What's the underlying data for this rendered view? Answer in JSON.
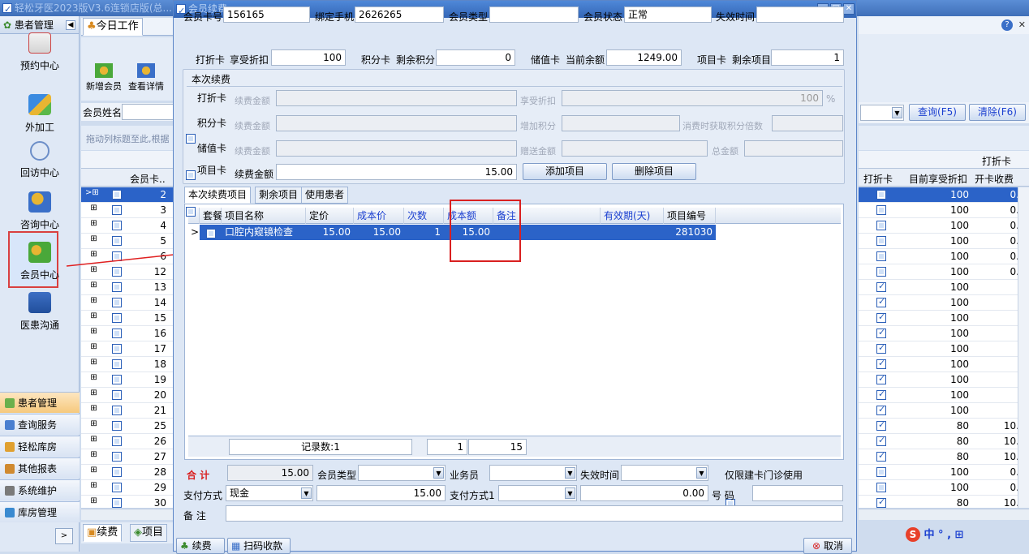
{
  "app": {
    "title": "轻松牙医2023版V3.6连锁店版(总...",
    "taskbar_right": "中 ° , ⊞"
  },
  "sidebar": {
    "header": "患者管理",
    "items": [
      {
        "label": "预约中心"
      },
      {
        "label": "外加工"
      },
      {
        "label": "回访中心"
      },
      {
        "label": "咨询中心"
      },
      {
        "label": "会员中心"
      },
      {
        "label": "医患沟通"
      }
    ],
    "bottom": [
      {
        "label": "患者管理"
      },
      {
        "label": "查询服务"
      },
      {
        "label": "轻松库房"
      },
      {
        "label": "其他报表"
      },
      {
        "label": "系统维护"
      },
      {
        "label": "库房管理"
      }
    ]
  },
  "bg": {
    "tab_today": "今日工作",
    "btn_new_member": "新增会员",
    "btn_view_detail": "查看详情",
    "member_name_label": "会员姓名",
    "drag_hint": "拖动列标题至此,根据",
    "col_card": "会员卡..",
    "rows": [
      "2",
      "3",
      "4",
      "5",
      "6",
      "12",
      "13",
      "14",
      "15",
      "16",
      "17",
      "18",
      "19",
      "20",
      "21",
      "25",
      "26",
      "27",
      "28",
      "29",
      "30"
    ],
    "btn_query": "查询(F5)",
    "btn_clear": "清除(F6)",
    "right_group": "打折卡",
    "right_cols": [
      "打折卡",
      "目前享受折扣",
      "开卡收费"
    ],
    "right_rows": [
      {
        "disc": "100",
        "fee": "0."
      },
      {
        "disc": "100",
        "fee": "0."
      },
      {
        "disc": "100",
        "fee": "0."
      },
      {
        "disc": "100",
        "fee": "0."
      },
      {
        "disc": "100",
        "fee": "0."
      },
      {
        "disc": "100",
        "fee": "0."
      },
      {
        "disc": "100",
        "fee": ""
      },
      {
        "disc": "100",
        "fee": ""
      },
      {
        "disc": "100",
        "fee": ""
      },
      {
        "disc": "100",
        "fee": ""
      },
      {
        "disc": "100",
        "fee": ""
      },
      {
        "disc": "100",
        "fee": ""
      },
      {
        "disc": "100",
        "fee": ""
      },
      {
        "disc": "100",
        "fee": ""
      },
      {
        "disc": "100",
        "fee": ""
      },
      {
        "disc": "80",
        "fee": "10."
      },
      {
        "disc": "80",
        "fee": "10."
      },
      {
        "disc": "80",
        "fee": "10."
      },
      {
        "disc": "100",
        "fee": "0."
      },
      {
        "disc": "100",
        "fee": "0."
      },
      {
        "disc": "80",
        "fee": "10."
      }
    ],
    "bottom_tabs": [
      "续费",
      "项目"
    ]
  },
  "dialog": {
    "title": "会员续费",
    "row1": {
      "card_no_label": "会员卡号",
      "card_no": "156165",
      "phone_label": "绑定手机",
      "phone": "2626265",
      "type_label": "会员类型",
      "type": "",
      "status_label": "会员状态",
      "status": "正常",
      "expire_label": "失效时间",
      "expire": ""
    },
    "row2": {
      "discount_card": "打折卡",
      "discount_label": "享受折扣",
      "discount": "100",
      "points_card": "积分卡",
      "points_label": "剩余积分",
      "points": "0",
      "stored_card": "储值卡",
      "balance_label": "当前余额",
      "balance": "1249.00",
      "item_card": "项目卡",
      "items_label": "剩余项目",
      "items": "1"
    },
    "section_title": "本次续费",
    "renew_rows": [
      {
        "card": "打折卡",
        "f1": "续费金额",
        "f2": "享受折扣",
        "v2": "100",
        "unit": "%"
      },
      {
        "card": "积分卡",
        "f1": "续费金额",
        "f2": "增加积分",
        "f3": "消费时获取积分倍数"
      },
      {
        "card": "储值卡",
        "f1": "续费金额",
        "f2": "赠送金额",
        "f3": "总金额"
      }
    ],
    "item_row": {
      "card": "项目卡",
      "label": "续费金额",
      "amount": "15.00",
      "add": "添加项目",
      "del": "删除项目"
    },
    "tabs": [
      "本次续费项目",
      "剩余项目",
      "使用患者"
    ],
    "grid_cols": [
      "套餐",
      "项目名称",
      "定价",
      "成本价",
      "次数",
      "成本额",
      "备注",
      "有效期(天)",
      "项目编号"
    ],
    "grid_row": {
      "name": "口腔内窥镜检查",
      "price": "15.00",
      "cost": "15.00",
      "times": "1",
      "cost_amt": "15.00",
      "note": "",
      "valid": "",
      "code": "281030"
    },
    "footer": {
      "count": "记录数:1",
      "times": "1",
      "cost_amt": "15"
    },
    "total": {
      "label": "合 计",
      "value": "15.00",
      "type_label": "会员类型",
      "staff_label": "业务员",
      "expire_label": "失效时间",
      "only_label": "仅限建卡门诊使用"
    },
    "pay": {
      "label": "支付方式",
      "method": "现金",
      "amount": "15.00",
      "label1": "支付方式1",
      "amount1": "0.00",
      "code_label": "号 码"
    },
    "note_label": "备 注",
    "bottom_btns": {
      "renew": "续费",
      "scan": "扫码收款",
      "cancel": "取消"
    }
  }
}
